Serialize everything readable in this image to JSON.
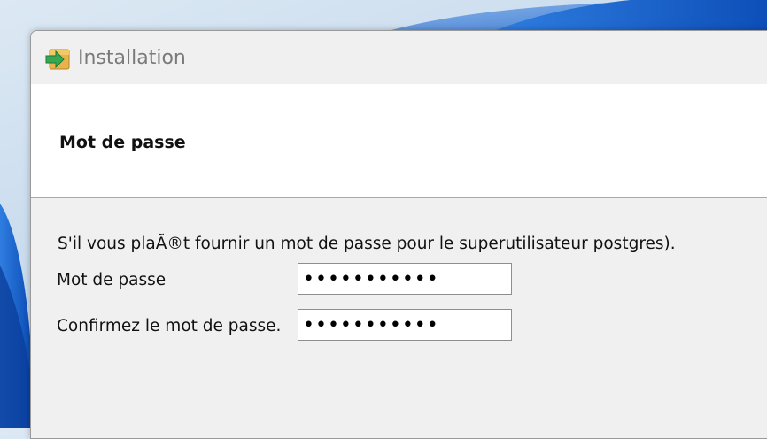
{
  "window": {
    "title": "Installation",
    "icon": "installer-box-arrow-icon"
  },
  "header": {
    "title": "Mot de passe"
  },
  "form": {
    "instruction": "S'il vous plaÃ®t fournir un mot de passe pour le superutilisateur postgres).",
    "password_label": "Mot de passe",
    "password_value": "•••••••••••",
    "confirm_label": "Confirmez le mot de passe.",
    "confirm_value": "•••••••••••"
  },
  "colors": {
    "window_bg": "#f0f0f0",
    "header_bg": "#ffffff",
    "title_text": "#7a7a7a",
    "wallpaper_blue": "#1d6fd8"
  }
}
